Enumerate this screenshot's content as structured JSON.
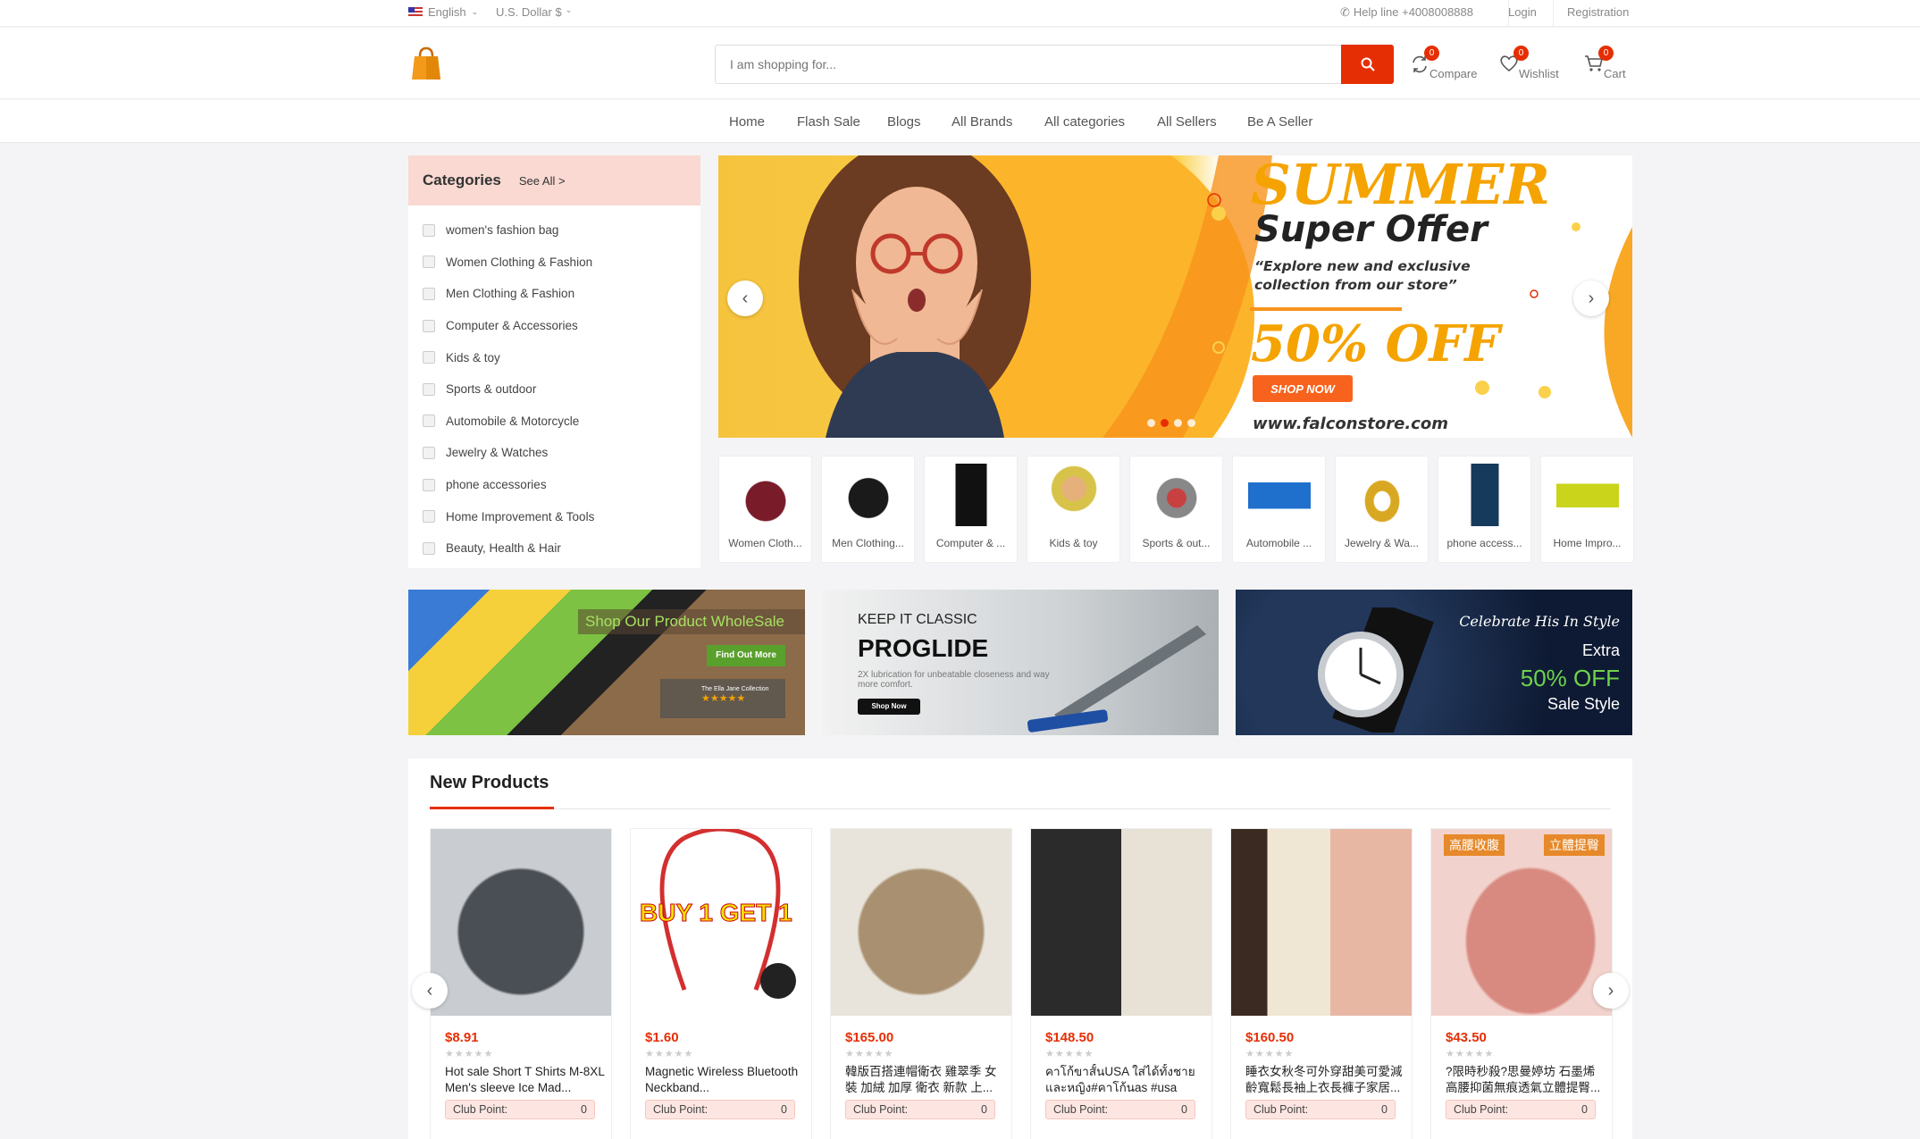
{
  "topbar": {
    "language": "English",
    "currency": "U.S. Dollar $",
    "helpline": "Help line +4008008888",
    "login": "Login",
    "registration": "Registration"
  },
  "header": {
    "search_placeholder": "I am shopping for...",
    "compare": {
      "label": "Compare",
      "count": "0"
    },
    "wishlist": {
      "label": "Wishlist",
      "count": "0"
    },
    "cart": {
      "label": "Cart",
      "count": "0"
    }
  },
  "nav": [
    "Home",
    "Flash Sale",
    "Blogs",
    "All Brands",
    "All categories",
    "All Sellers",
    "Be A Seller"
  ],
  "categories": {
    "title": "Categories",
    "see_all": "See All >",
    "items": [
      "women's fashion bag",
      "Women Clothing & Fashion",
      "Men Clothing & Fashion",
      "Computer & Accessories",
      "Kids & toy",
      "Sports & outdoor",
      "Automobile & Motorcycle",
      "Jewelry & Watches",
      "phone accessories",
      "Home Improvement & Tools",
      "Beauty, Health & Hair"
    ]
  },
  "slider": {
    "title1": "SUMMER",
    "title2": "Super Offer",
    "tagline": "“Explore new and exclusive collection from our store”",
    "discount": "50% OFF",
    "cta": "SHOP NOW",
    "url": "www.falconstore.com",
    "slides": 4,
    "active_slide": 2
  },
  "mini_categories": [
    "Women Cloth...",
    "Men Clothing...",
    "Computer & ...",
    "Kids & toy",
    "Sports & out...",
    "Automobile ...",
    "Jewelry & Wa...",
    "phone access...",
    "Home Impro..."
  ],
  "banners": {
    "b1": {
      "headline": "Shop Our Product WholeSale",
      "button": "Find Out More",
      "brand": "The Ella Jane Collection",
      "stars": "★★★★★"
    },
    "b2": {
      "line1": "KEEP IT CLASSIC",
      "line2": "PROGLIDE",
      "sub": "2X lubrication for unbeatable closeness and way more comfort.",
      "button": "Shop Now"
    },
    "b3": {
      "script": "Celebrate His In Style",
      "extra": "Extra",
      "discount": "50% OFF",
      "sale": "Sale Style"
    }
  },
  "new_products": {
    "title": "New Products",
    "items": [
      {
        "price": "$8.91",
        "name": "Hot sale Short T Shirts M-8XL Men's sleeve Ice Mad...",
        "club_label": "Club Point:",
        "club_value": "0"
      },
      {
        "price": "$1.60",
        "name": "Magnetic Wireless Bluetooth Neckband...",
        "club_label": "Club Point:",
        "club_value": "0",
        "img_text": "BUY 1 GET 1"
      },
      {
        "price": "$165.00",
        "name": "韓版百搭連帽衛衣 雞翠季 女裝 加絨 加厚 衛衣 新款 上...",
        "club_label": "Club Point:",
        "club_value": "0"
      },
      {
        "price": "$148.50",
        "name": "คาโก้ขาสั้นUSA ใส่ได้ทั้งชาย และหญิง#คาโก้นas #usa",
        "club_label": "Club Point:",
        "club_value": "0"
      },
      {
        "price": "$160.50",
        "name": "睡衣女秋冬可外穿甜美可愛減齡寬鬆長袖上衣長褲子家居...",
        "club_label": "Club Point:",
        "club_value": "0"
      },
      {
        "price": "$43.50",
        "name": "?限時秒殺?思曼婷坊 石墨烯 高腰抑菌無痕透氣立體提臀...",
        "club_label": "Club Point:",
        "club_value": "0",
        "img_tag1": "高腰收腹",
        "img_tag2": "立體提臀"
      }
    ]
  },
  "colors": {
    "accent": "#e62e04",
    "category_header": "#f9d9d2",
    "slider_yellow": "#f6c33d"
  }
}
